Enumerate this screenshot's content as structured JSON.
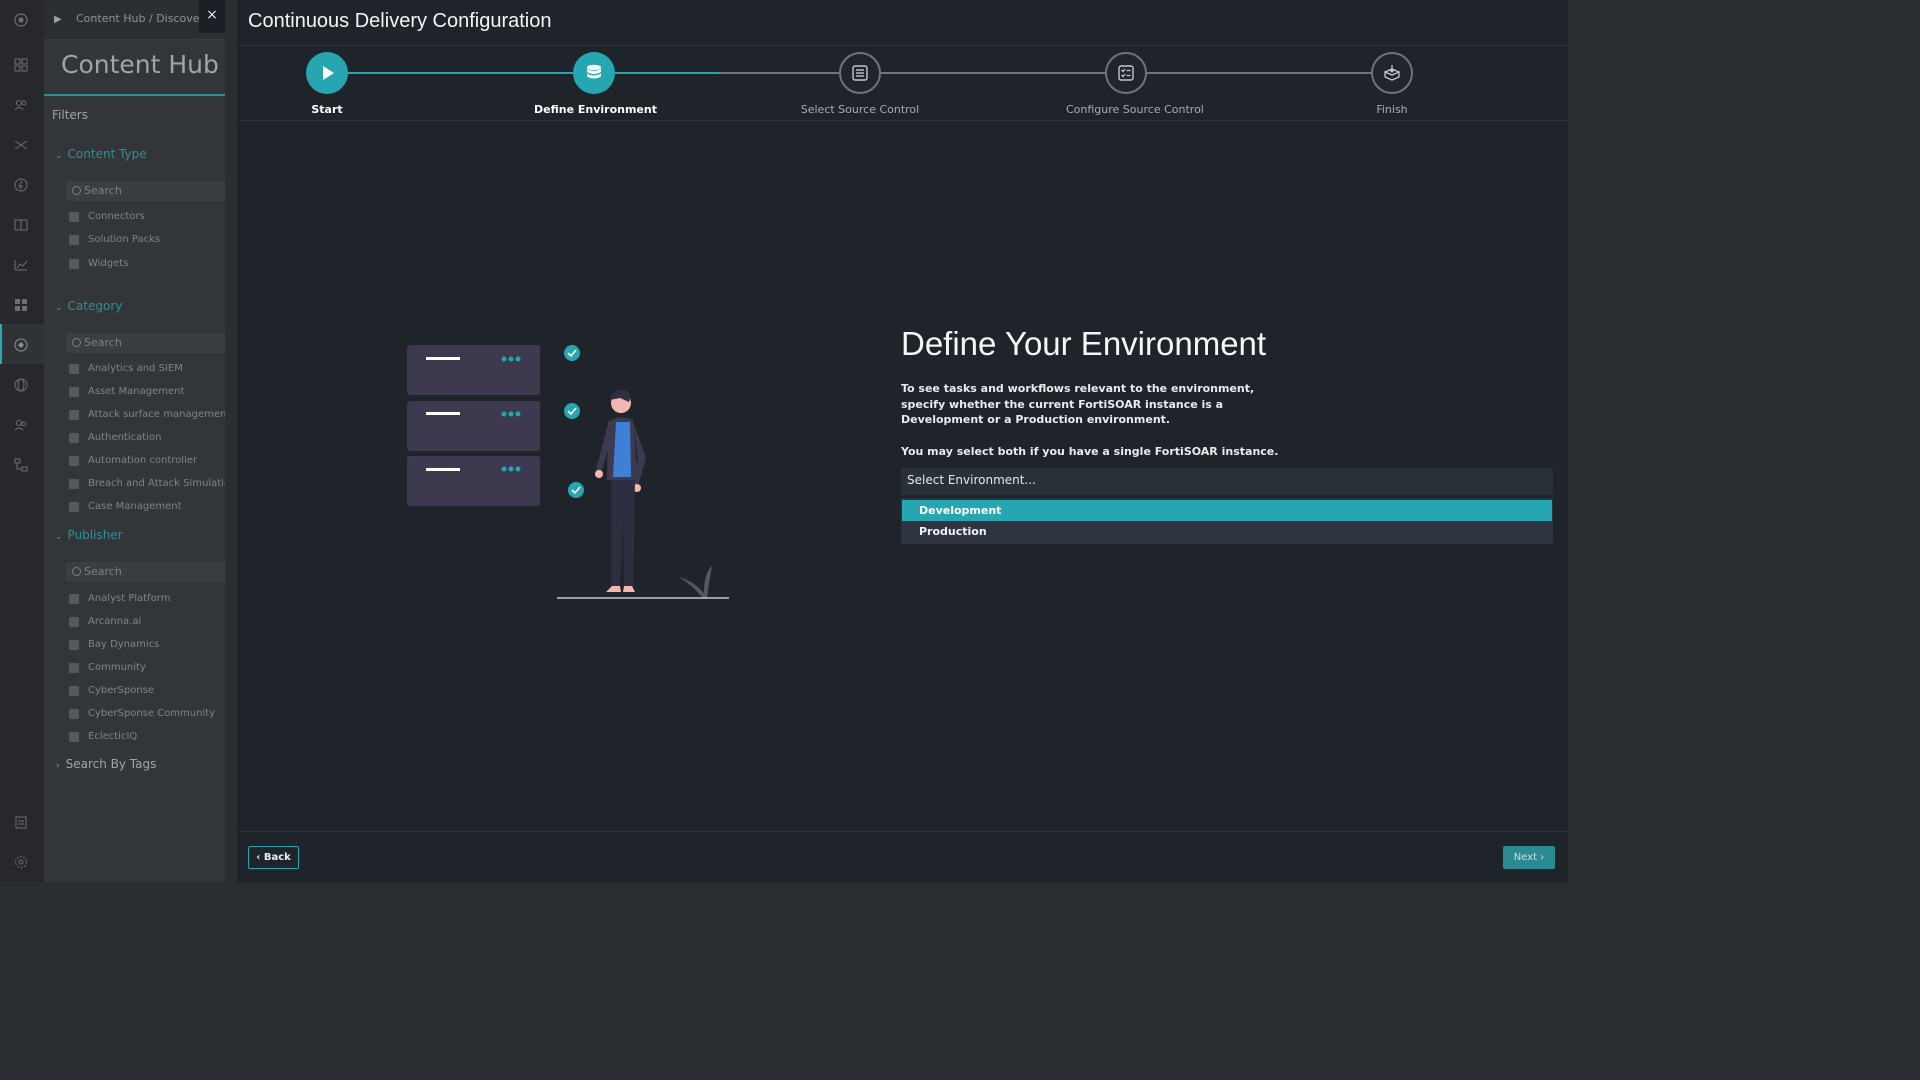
{
  "hub": {
    "breadcrumb": [
      "Content Hub",
      "/",
      "Discover"
    ],
    "title": "Content Hub",
    "filters_label": "Filters",
    "content_type": {
      "label": "Content Type",
      "search_placeholder": "Search",
      "items": [
        "Connectors",
        "Solution Packs",
        "Widgets"
      ]
    },
    "category": {
      "label": "Category",
      "search_placeholder": "Search",
      "items": [
        "Analytics and SIEM",
        "Asset Management",
        "Attack surface management",
        "Authentication",
        "Automation controller",
        "Breach and Attack Simulation",
        "Case Management"
      ]
    },
    "publisher": {
      "label": "Publisher",
      "search_placeholder": "Search",
      "items": [
        "Analyst Platform",
        "Arcanna.ai",
        "Bay Dynamics",
        "Community",
        "CyberSponse",
        "CyberSponse Community",
        "EclecticIQ"
      ]
    },
    "search_by_tags": "Search By Tags"
  },
  "modal": {
    "close_label": "×",
    "title": "Continuous Delivery Configuration",
    "steps": [
      {
        "label": "Start",
        "state": "done",
        "icon": "play-icon"
      },
      {
        "label": "Define Environment",
        "state": "done",
        "icon": "database-icon"
      },
      {
        "label": "Select Source Control",
        "state": "todo",
        "icon": "list-icon"
      },
      {
        "label": "Configure Source Control",
        "state": "todo",
        "icon": "checklist-icon"
      },
      {
        "label": "Finish",
        "state": "todo",
        "icon": "box-icon"
      }
    ],
    "heading": "Define Your Environment",
    "description": "To see tasks and workflows relevant to the environment, specify whether the current FortiSOAR instance is a Development or a Production environment.",
    "note": "You may select both if you have a single FortiSOAR instance.",
    "select_placeholder": "Select Environment...",
    "options": [
      {
        "label": "Development",
        "highlighted": true
      },
      {
        "label": "Production",
        "highlighted": false
      }
    ],
    "back_label": "Back",
    "next_label": "Next"
  },
  "colors": {
    "accent": "#26a6b0",
    "modal_bg": "#1f242b",
    "panel_bg": "#333639"
  }
}
